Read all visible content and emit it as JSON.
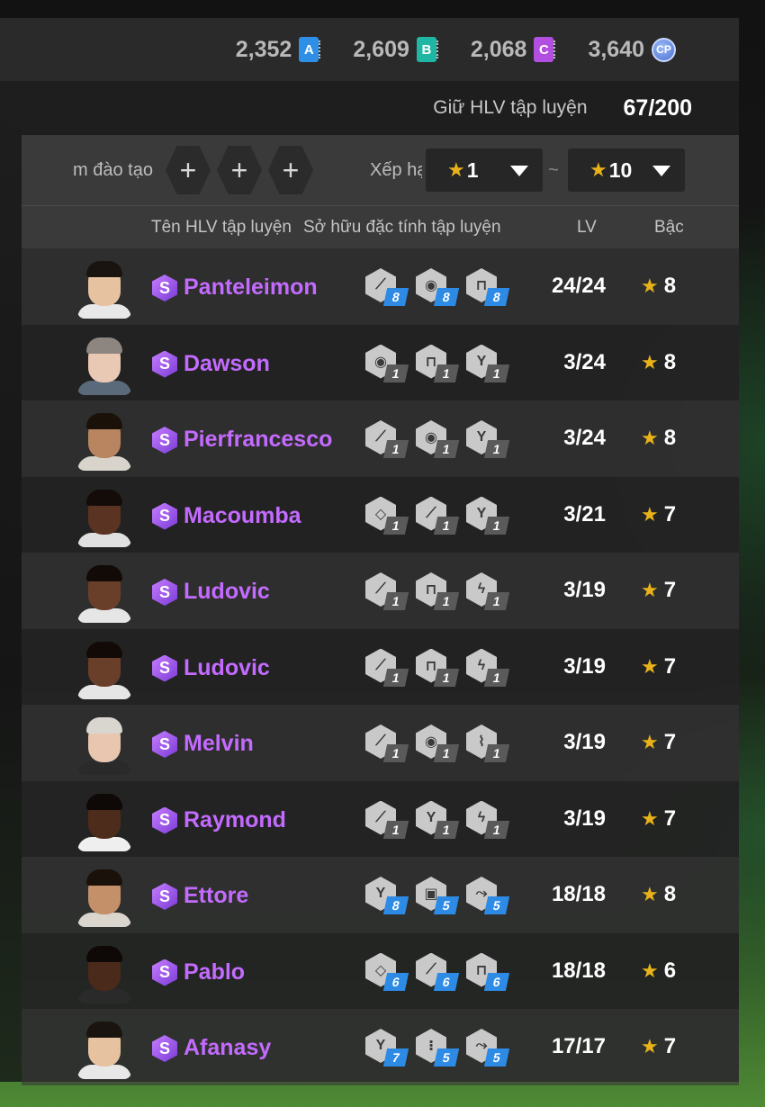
{
  "currency": [
    {
      "value": "2,352",
      "badge": "A",
      "color": "#2e8fe6"
    },
    {
      "value": "2,609",
      "badge": "B",
      "color": "#1fb7a4"
    },
    {
      "value": "2,068",
      "badge": "C",
      "color": "#b34fe0"
    },
    {
      "value": "3,640",
      "badge": "CP",
      "color": "#5b7fdb"
    }
  ],
  "slots": {
    "label": "Giữ HLV tập luyện",
    "value": "67/200"
  },
  "filter": {
    "training_label": "Điểm đào tạo",
    "plus": "+",
    "rank_label": "Xếp hạng",
    "star": "★",
    "from": "1",
    "tilde": "~",
    "to": "10"
  },
  "header": {
    "name": "Tên HLV tập luyện",
    "traits": "Sở hữu đặc tính tập luyện",
    "lv": "LV",
    "grade": "Bậc"
  },
  "rows": [
    {
      "name": "Panteleimon",
      "level": "24/24",
      "grade": "8",
      "traits": [
        {
          "icon": "boot-icon",
          "lv": "8",
          "up": true
        },
        {
          "icon": "ball-shield-icon",
          "lv": "8",
          "up": true
        },
        {
          "icon": "goal-icon",
          "lv": "8",
          "up": true
        }
      ]
    },
    {
      "name": "Dawson",
      "level": "3/24",
      "grade": "8",
      "traits": [
        {
          "icon": "ball-shield-icon",
          "lv": "1",
          "up": false
        },
        {
          "icon": "goal-icon",
          "lv": "1",
          "up": false
        },
        {
          "icon": "jump-icon",
          "lv": "1",
          "up": false
        }
      ]
    },
    {
      "name": "Pierfrancesco",
      "level": "3/24",
      "grade": "8",
      "traits": [
        {
          "icon": "boot-icon",
          "lv": "1",
          "up": false
        },
        {
          "icon": "ball-shield-icon",
          "lv": "1",
          "up": false
        },
        {
          "icon": "jump-icon",
          "lv": "1",
          "up": false
        }
      ]
    },
    {
      "name": "Macoumba",
      "level": "3/21",
      "grade": "7",
      "traits": [
        {
          "icon": "eye-icon",
          "lv": "1",
          "up": false
        },
        {
          "icon": "boot-icon",
          "lv": "1",
          "up": false
        },
        {
          "icon": "jump-icon",
          "lv": "1",
          "up": false
        }
      ]
    },
    {
      "name": "Ludovic",
      "level": "3/19",
      "grade": "7",
      "traits": [
        {
          "icon": "boot-icon",
          "lv": "1",
          "up": false
        },
        {
          "icon": "goal-icon",
          "lv": "1",
          "up": false
        },
        {
          "icon": "sprint-icon",
          "lv": "1",
          "up": false
        }
      ]
    },
    {
      "name": "Ludovic",
      "level": "3/19",
      "grade": "7",
      "traits": [
        {
          "icon": "boot-icon",
          "lv": "1",
          "up": false
        },
        {
          "icon": "goal-icon",
          "lv": "1",
          "up": false
        },
        {
          "icon": "sprint-icon",
          "lv": "1",
          "up": false
        }
      ]
    },
    {
      "name": "Melvin",
      "level": "3/19",
      "grade": "7",
      "traits": [
        {
          "icon": "boot-icon",
          "lv": "1",
          "up": false
        },
        {
          "icon": "ball-shield-icon",
          "lv": "1",
          "up": false
        },
        {
          "icon": "tackle-icon",
          "lv": "1",
          "up": false
        }
      ]
    },
    {
      "name": "Raymond",
      "level": "3/19",
      "grade": "7",
      "traits": [
        {
          "icon": "boot-icon",
          "lv": "1",
          "up": false
        },
        {
          "icon": "jump-icon",
          "lv": "1",
          "up": false
        },
        {
          "icon": "sprint-icon",
          "lv": "1",
          "up": false
        }
      ]
    },
    {
      "name": "Ettore",
      "level": "18/18",
      "grade": "8",
      "traits": [
        {
          "icon": "jump-icon",
          "lv": "8",
          "up": true
        },
        {
          "icon": "keeper-icon",
          "lv": "5",
          "up": true
        },
        {
          "icon": "pass-icon",
          "lv": "5",
          "up": true
        }
      ]
    },
    {
      "name": "Pablo",
      "level": "18/18",
      "grade": "6",
      "traits": [
        {
          "icon": "eye-icon",
          "lv": "6",
          "up": true
        },
        {
          "icon": "boot-icon",
          "lv": "6",
          "up": true
        },
        {
          "icon": "goal-icon",
          "lv": "6",
          "up": true
        }
      ]
    },
    {
      "name": "Afanasy",
      "level": "17/17",
      "grade": "7",
      "traits": [
        {
          "icon": "jump-icon",
          "lv": "7",
          "up": true
        },
        {
          "icon": "dribble-icon",
          "lv": "5",
          "up": true
        },
        {
          "icon": "pass-icon",
          "lv": "5",
          "up": true
        }
      ]
    }
  ],
  "avatars": [
    {
      "skin": "#e6c2a0",
      "hair": "#1a1410",
      "shirt": "#e8e8e8"
    },
    {
      "skin": "#e9c8b4",
      "hair": "#8d8680",
      "shirt": "#5a6a7a"
    },
    {
      "skin": "#b98560",
      "hair": "#1a1208",
      "shirt": "#d8d4cc"
    },
    {
      "skin": "#5a3322",
      "hair": "#140c08",
      "shirt": "#e0e0e0"
    },
    {
      "skin": "#6a3f2a",
      "hair": "#120a06",
      "shirt": "#e6e6e6"
    },
    {
      "skin": "#6a3f2a",
      "hair": "#120a06",
      "shirt": "#e6e6e6"
    },
    {
      "skin": "#e8c6b0",
      "hair": "#d9d6d0",
      "shirt": "#2a2a2a"
    },
    {
      "skin": "#4e2c1c",
      "hair": "#0e0806",
      "shirt": "#efefef"
    },
    {
      "skin": "#c4906a",
      "hair": "#1a120a",
      "shirt": "#dad6ce"
    },
    {
      "skin": "#4a2a1a",
      "hair": "#0e0806",
      "shirt": "#2a2a2a"
    },
    {
      "skin": "#e6c2a0",
      "hair": "#1a1410",
      "shirt": "#e8e8e8"
    }
  ]
}
